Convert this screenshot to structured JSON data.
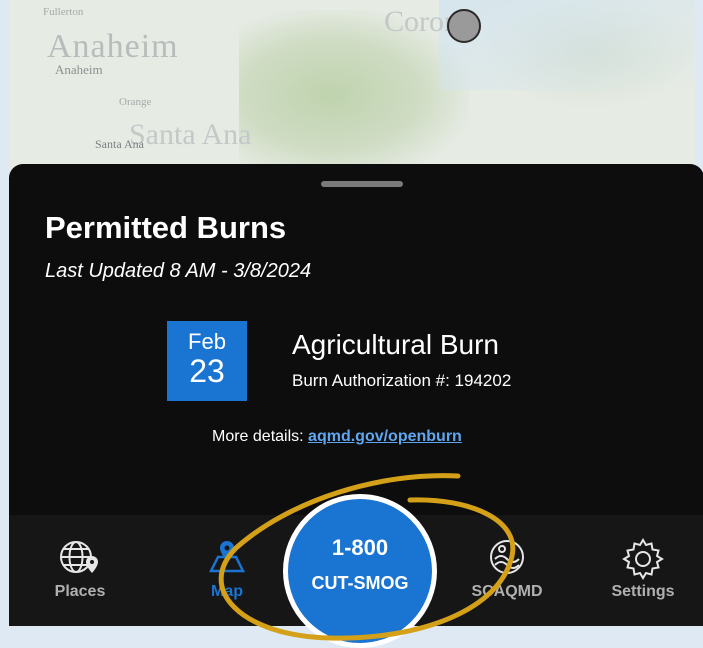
{
  "map": {
    "labels": {
      "fullerton": "Fullerton",
      "anaheim_large": "Anaheim",
      "anaheim": "Anaheim",
      "orange": "Orange",
      "santa_ana_large": "Santa Ana",
      "santa_ana": "Santa Ana",
      "corona": "Corona"
    },
    "pin_color": "#9a9a9a"
  },
  "sheet": {
    "title": "Permitted Burns",
    "last_updated": "Last Updated 8 AM - 3/8/2024",
    "burn": {
      "month": "Feb",
      "day": "23",
      "type": "Agricultural Burn",
      "authorization": "Burn Authorization #: 194202"
    },
    "details_prefix": "More details: ",
    "details_link": "aqmd.gov/openburn"
  },
  "nav": {
    "places": "Places",
    "map": "Map",
    "scaqmd": "SCAQMD",
    "settings": "Settings",
    "cta_line1": "1-800",
    "cta_line2": "CUT-SMOG"
  },
  "colors": {
    "accent": "#1a74d2",
    "sheet_bg": "#0d0d0d",
    "annotation": "#d4a017"
  },
  "icons": [
    "globe-pin-icon",
    "map-icon",
    "scaqmd-icon",
    "gear-icon"
  ]
}
